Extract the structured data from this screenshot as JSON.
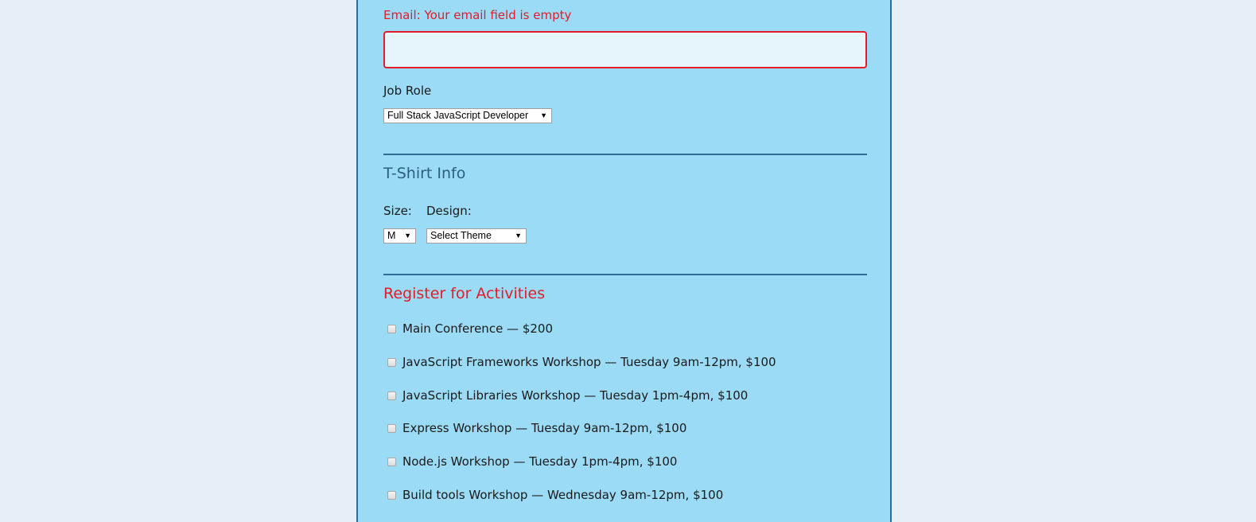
{
  "email": {
    "error_text": "Email: Your email field is empty",
    "value": "",
    "error_color": "#e41b2a"
  },
  "job_role": {
    "label": "Job Role",
    "selected": "Full Stack JavaScript Developer"
  },
  "tshirt": {
    "title": "T-Shirt Info",
    "size_label": "Size:",
    "size_selected": "M",
    "design_label": "Design:",
    "design_selected": "Select Theme"
  },
  "activities": {
    "title": "Register for Activities",
    "title_color": "#e41b2a",
    "items": [
      {
        "label": "Main Conference — $200",
        "checked": false
      },
      {
        "label": "JavaScript Frameworks Workshop — Tuesday 9am-12pm, $100",
        "checked": false
      },
      {
        "label": "JavaScript Libraries Workshop — Tuesday 1pm-4pm, $100",
        "checked": false
      },
      {
        "label": "Express Workshop — Tuesday 9am-12pm, $100",
        "checked": false
      },
      {
        "label": "Node.js Workshop — Tuesday 1pm-4pm, $100",
        "checked": false
      },
      {
        "label": "Build tools Workshop — Wednesday 9am-12pm, $100",
        "checked": false
      }
    ]
  },
  "colors": {
    "page_background": "#e6eff7",
    "panel_background": "#9bdbf5",
    "panel_border": "#2f6d94",
    "section_title": "#2b5f80"
  }
}
